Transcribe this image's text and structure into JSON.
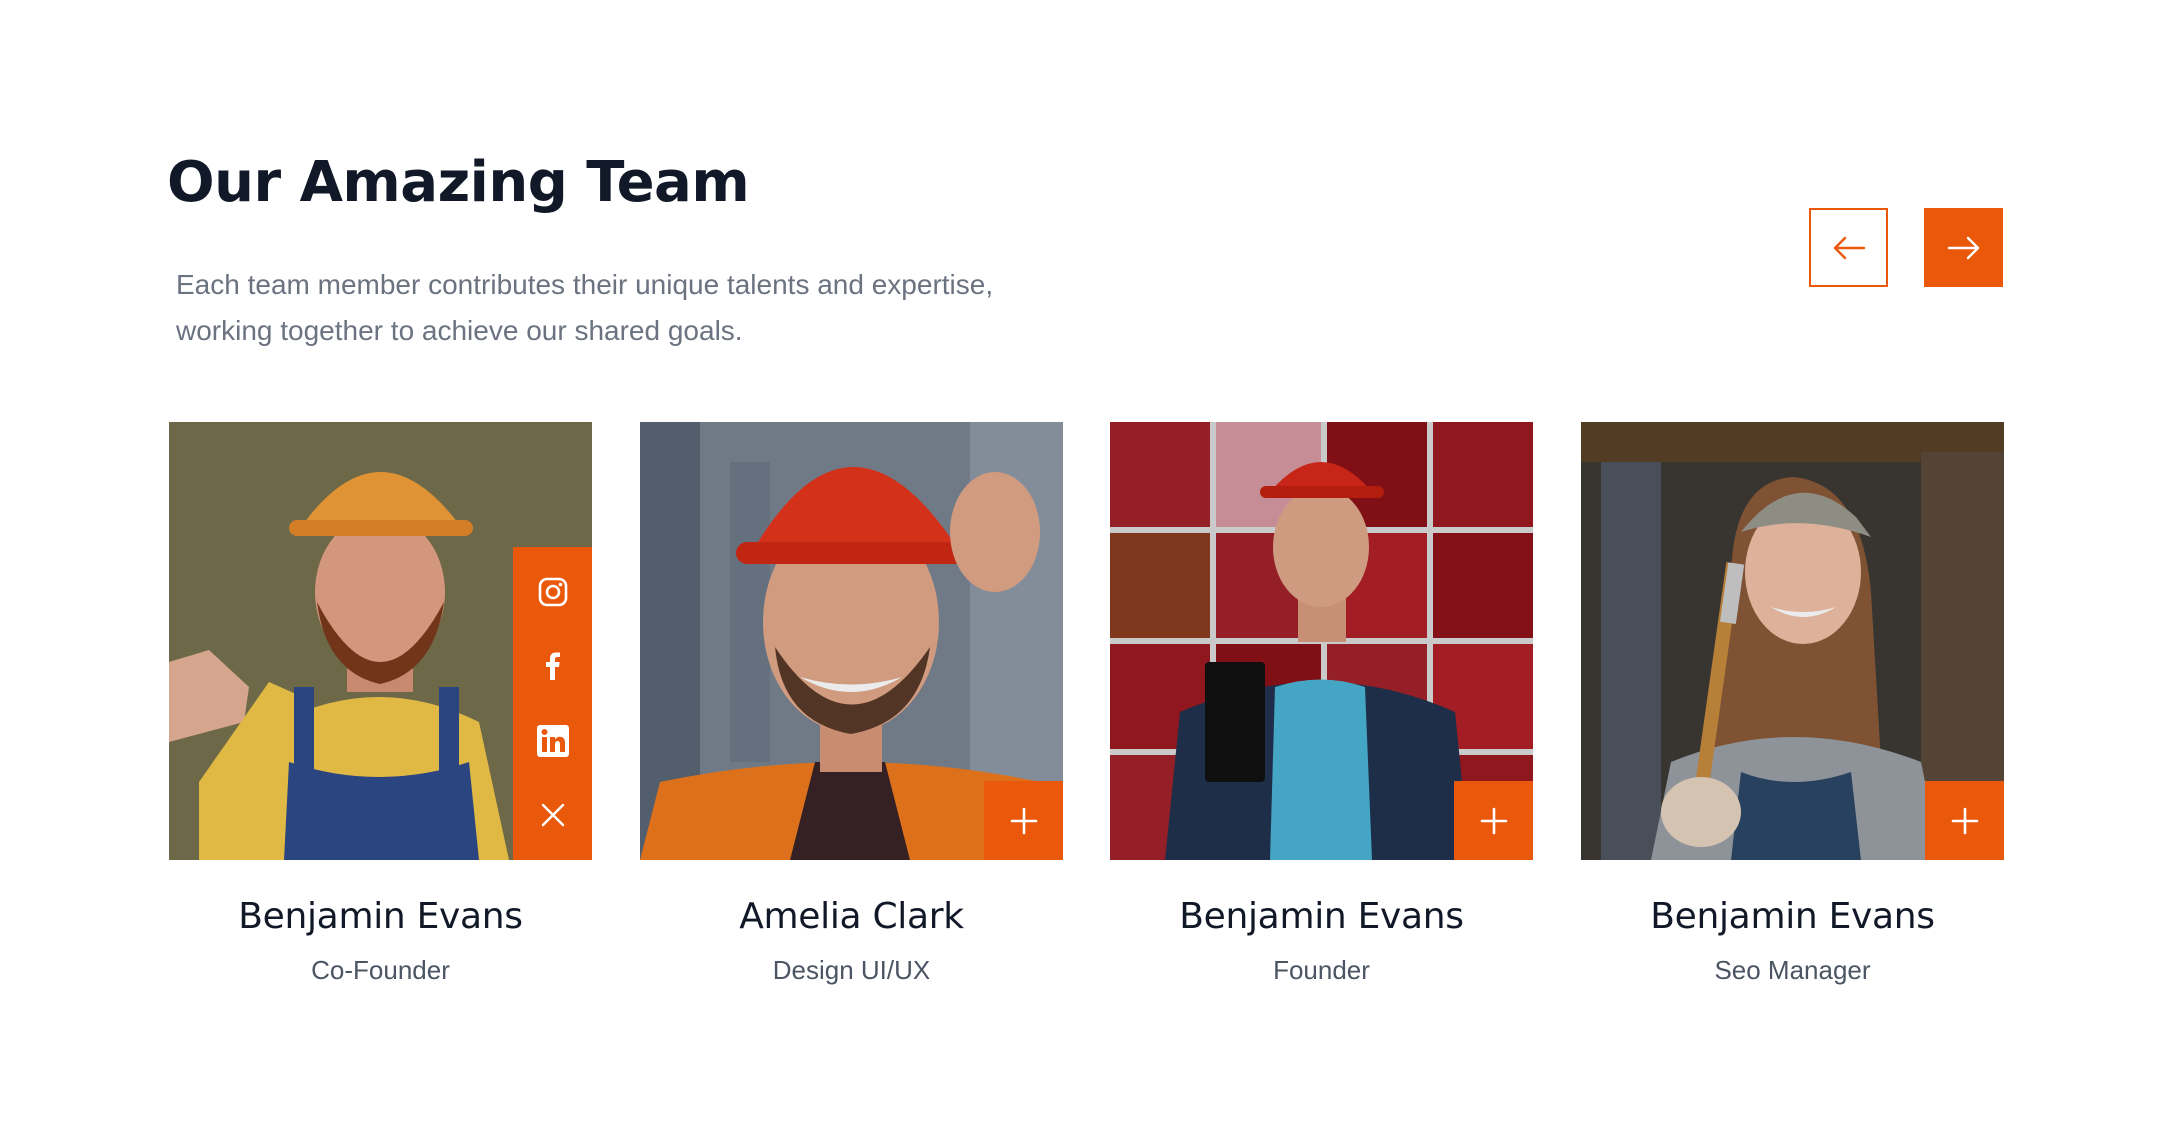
{
  "section": {
    "title": "Our Amazing Team",
    "description": "Each team member contributes their unique talents and expertise, working together to achieve our shared goals."
  },
  "nav": {
    "prev_icon": "arrow-left-icon",
    "next_icon": "arrow-right-icon"
  },
  "colors": {
    "accent": "#ea580c",
    "heading": "#111827",
    "muted": "#6b7280"
  },
  "team": [
    {
      "name": "Benjamin Evans",
      "role": "Co-Founder",
      "social_open": true,
      "social_icons": [
        "instagram-icon",
        "facebook-icon",
        "linkedin-icon",
        "close-icon"
      ]
    },
    {
      "name": "Amelia Clark",
      "role": "Design UI/UX",
      "social_open": false
    },
    {
      "name": "Benjamin Evans",
      "role": "Founder",
      "social_open": false
    },
    {
      "name": "Benjamin Evans",
      "role": "Seo Manager",
      "social_open": false
    }
  ]
}
